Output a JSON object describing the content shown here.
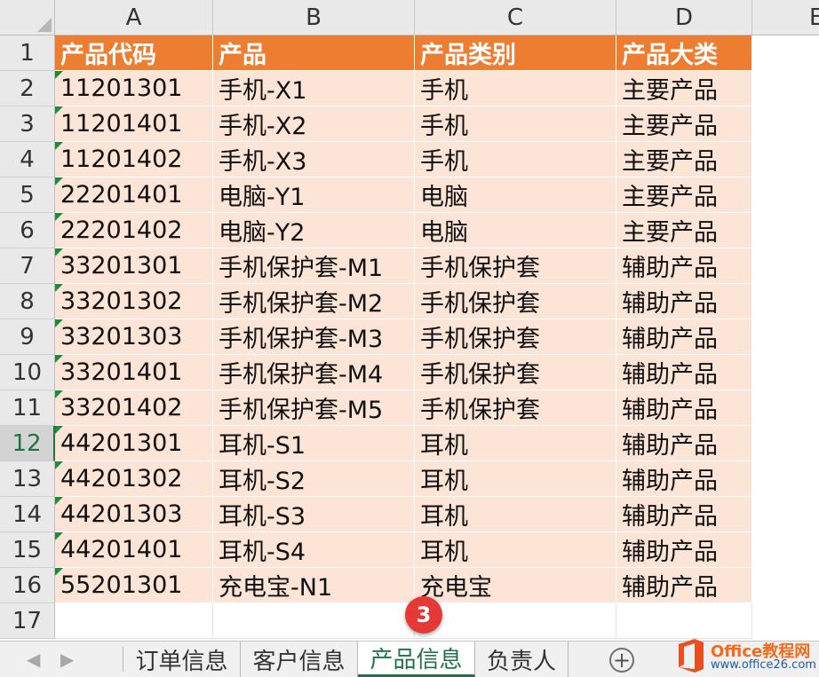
{
  "columns": [
    "A",
    "B",
    "C",
    "D",
    "E"
  ],
  "row_numbers": [
    "1",
    "2",
    "3",
    "4",
    "5",
    "6",
    "7",
    "8",
    "9",
    "10",
    "11",
    "12",
    "13",
    "14",
    "15",
    "16",
    "17"
  ],
  "active_row": "12",
  "table": {
    "headers": [
      "产品代码",
      "产品",
      "产品类别",
      "产品大类"
    ],
    "rows": [
      [
        "11201301",
        "手机-X1",
        "手机",
        "主要产品"
      ],
      [
        "11201401",
        "手机-X2",
        "手机",
        "主要产品"
      ],
      [
        "11201402",
        "手机-X3",
        "手机",
        "主要产品"
      ],
      [
        "22201401",
        "电脑-Y1",
        "电脑",
        "主要产品"
      ],
      [
        "22201402",
        "电脑-Y2",
        "电脑",
        "主要产品"
      ],
      [
        "33201301",
        "手机保护套-M1",
        "手机保护套",
        "辅助产品"
      ],
      [
        "33201302",
        "手机保护套-M2",
        "手机保护套",
        "辅助产品"
      ],
      [
        "33201303",
        "手机保护套-M3",
        "手机保护套",
        "辅助产品"
      ],
      [
        "33201401",
        "手机保护套-M4",
        "手机保护套",
        "辅助产品"
      ],
      [
        "33201402",
        "手机保护套-M5",
        "手机保护套",
        "辅助产品"
      ],
      [
        "44201301",
        "耳机-S1",
        "耳机",
        "辅助产品"
      ],
      [
        "44201302",
        "耳机-S2",
        "耳机",
        "辅助产品"
      ],
      [
        "44201303",
        "耳机-S3",
        "耳机",
        "辅助产品"
      ],
      [
        "44201401",
        "耳机-S4",
        "耳机",
        "辅助产品"
      ],
      [
        "55201301",
        "充电宝-N1",
        "充电宝",
        "辅助产品"
      ]
    ]
  },
  "sheet_tabs": [
    {
      "label": "订单信息",
      "active": false
    },
    {
      "label": "客户信息",
      "active": false
    },
    {
      "label": "产品信息",
      "active": true
    },
    {
      "label": "负责人",
      "active": false
    }
  ],
  "nav": {
    "prev": "◀",
    "next": "▶",
    "add": "+"
  },
  "marker": {
    "label": "3"
  },
  "watermark": {
    "line1": "Office教程网",
    "line2": "www.office26.com"
  },
  "colors": {
    "header_fill": "#ED7D31",
    "body_fill": "#FCE4D6",
    "accent_green": "#217346",
    "marker_red": "#E53935"
  }
}
